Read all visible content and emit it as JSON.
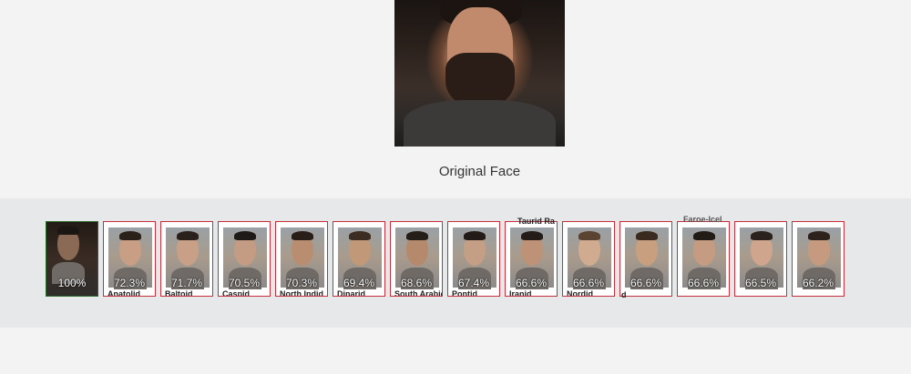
{
  "original": {
    "caption": "Original Face"
  },
  "matches": [
    {
      "percent": "100%",
      "label": "",
      "hair": "#1c1613",
      "skin": "#8a6a55"
    },
    {
      "percent": "72.3%",
      "label": "Anatolid",
      "hair": "#2b211b",
      "skin": "#c89f85"
    },
    {
      "percent": "71.7%",
      "label": "Baltoid",
      "hair": "#2a211c",
      "skin": "#c8a087"
    },
    {
      "percent": "70.5%",
      "label": "Caspid",
      "hair": "#1e1a18",
      "skin": "#c39c83"
    },
    {
      "percent": "70.3%",
      "label": "North Indid",
      "hair": "#2a1f18",
      "skin": "#b98d70"
    },
    {
      "percent": "69.4%",
      "label": "Dinarid",
      "hair": "#3b2d22",
      "skin": "#c19878"
    },
    {
      "percent": "68.6%",
      "label": "South Arabid",
      "hair": "#251d18",
      "skin": "#b5896c"
    },
    {
      "percent": "67.4%",
      "label": "Pontid",
      "hair": "#221b17",
      "skin": "#c59e86"
    },
    {
      "percent": "66.6%",
      "label": "Iranid",
      "hair": "#241c17",
      "skin": "#bd9276"
    },
    {
      "percent": "66.6%",
      "label": "Nordid",
      "hair": "#5a4330",
      "skin": "#d0ab90"
    },
    {
      "percent": "66.6%",
      "label": "",
      "hair": "#3a2a1f",
      "skin": "#c8a080"
    },
    {
      "percent": "66.6%",
      "label": "",
      "hair": "#231b16",
      "skin": "#c59c82"
    },
    {
      "percent": "66.5%",
      "label": "",
      "hair": "#2b221d",
      "skin": "#cfa68d"
    },
    {
      "percent": "66.2%",
      "label": "",
      "hair": "#2e231c",
      "skin": "#c69a7f"
    }
  ],
  "floating_labels": {
    "top_a": "Taurid Ra",
    "top_b": "Faroe-Icel",
    "below_a": "d"
  }
}
